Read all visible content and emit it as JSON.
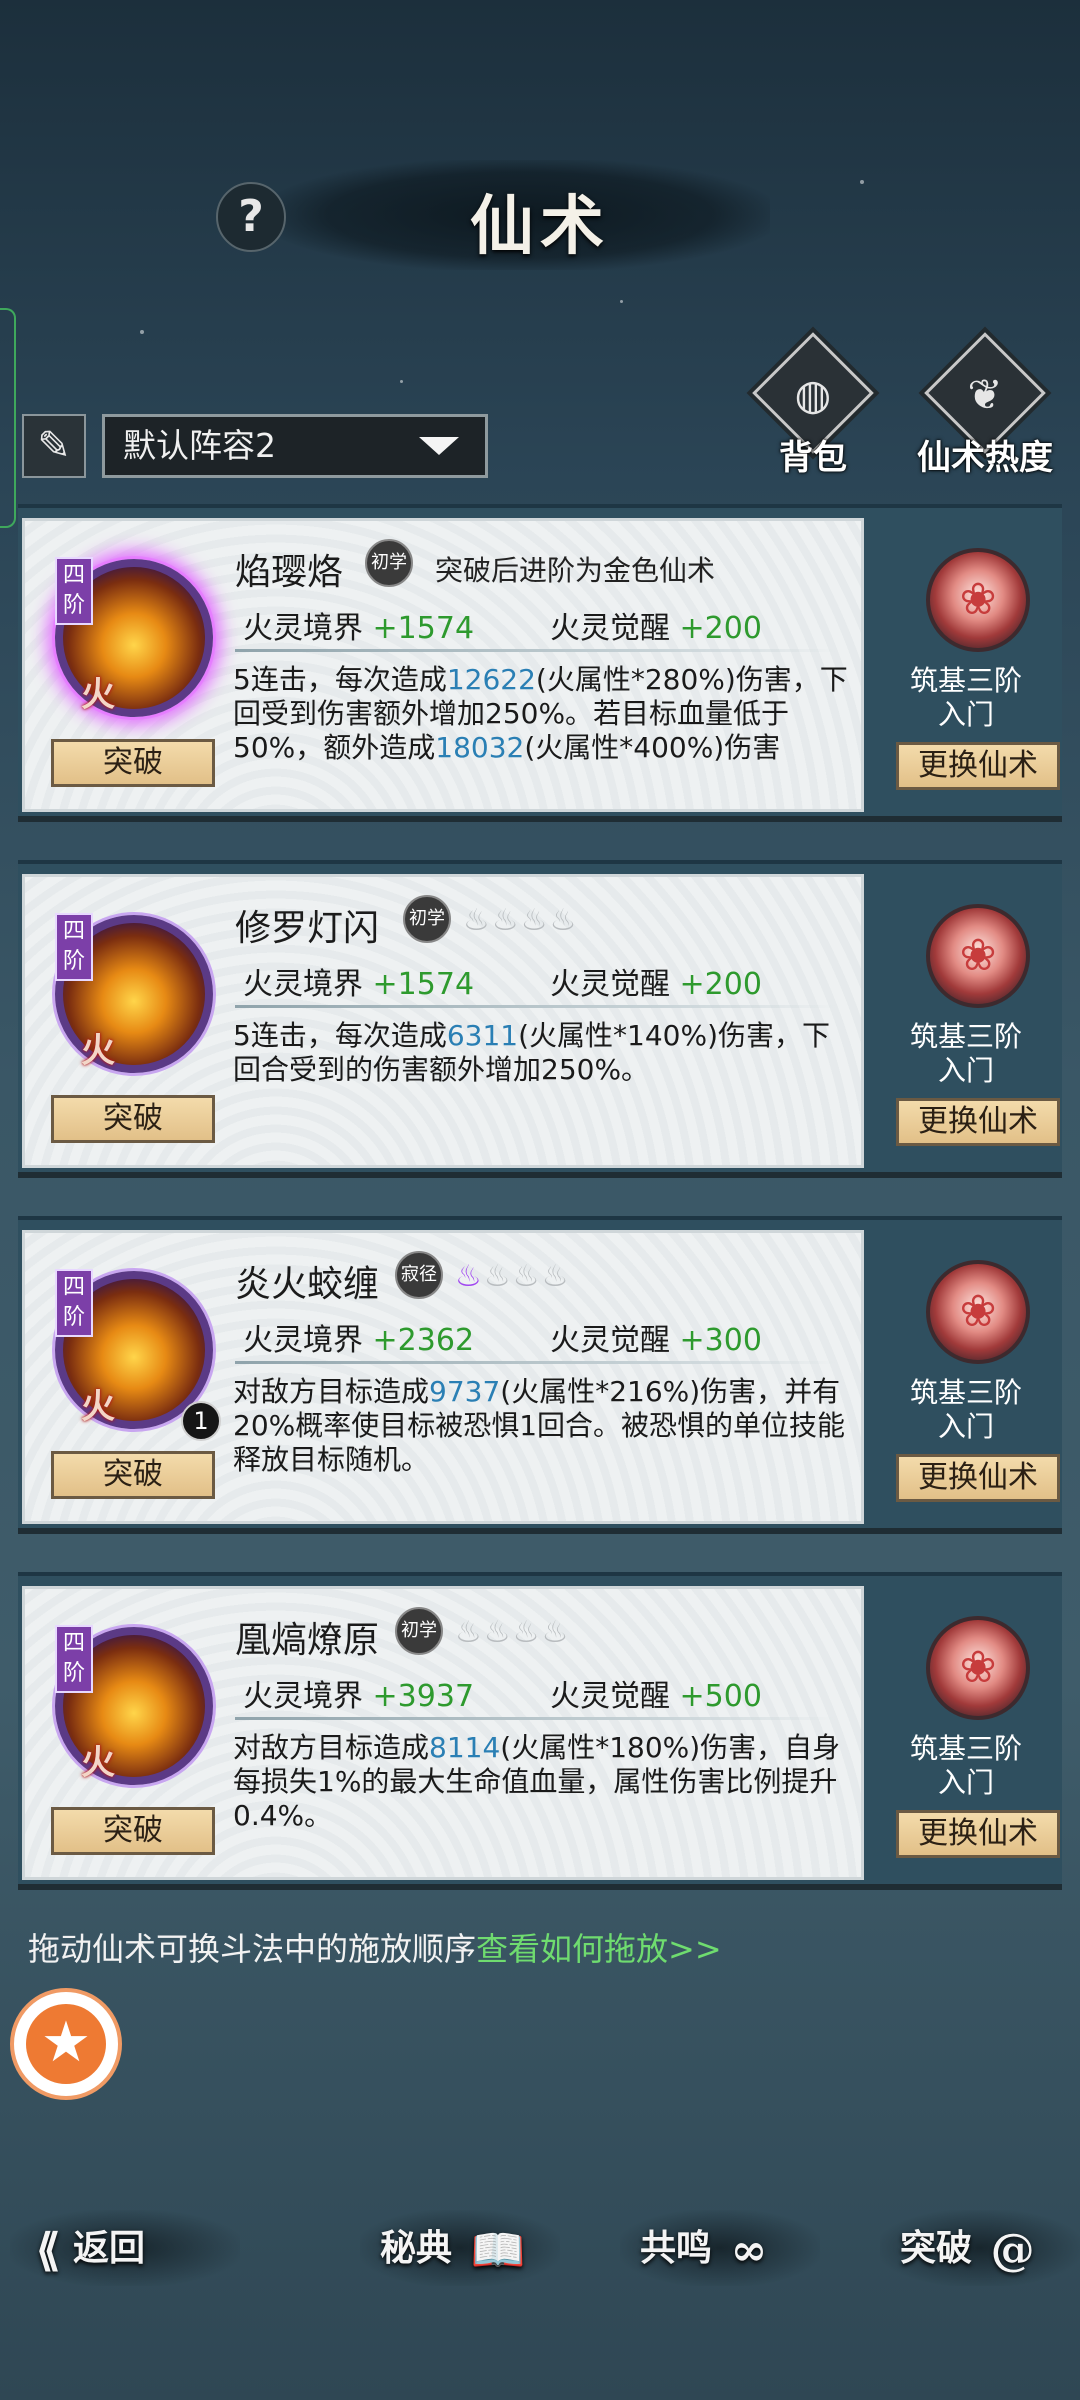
{
  "header": {
    "title": "仙术",
    "help_glyph": "?"
  },
  "toolbar": {
    "brush_glyph": "✎",
    "lineup_value": "默认阵容2",
    "bag_label": "背包",
    "bag_icon": "bag-icon",
    "popularity_label": "仙术热度",
    "popularity_icon": "book-icon"
  },
  "cards": [
    {
      "name": "焰璎烙",
      "level_badge": "初学",
      "promote_note": "突破后进阶为金色仙术",
      "rank": "四阶",
      "element": "火",
      "stat1_label": "火灵境界",
      "stat1_value": "+1574",
      "stat2_label": "火灵觉醒",
      "stat2_value": "+200",
      "desc": [
        {
          "t": "5连击，每次造成"
        },
        {
          "t": "12622",
          "n": true
        },
        {
          "t": "(火属性*280%)伤害，下回受到伤害额外增加250%。若目标血量低于50%，额外造成"
        },
        {
          "t": "18032",
          "n": true
        },
        {
          "t": "(火属性*400%)伤害"
        }
      ],
      "break_label": "突破",
      "realm": "筑基三阶\n入门",
      "realm_line1": "筑基三阶",
      "realm_line2": "入门",
      "swap_label": "更换仙术"
    },
    {
      "name": "修罗灯闪",
      "level_badge": "初学",
      "flames": "♨♨♨♨",
      "rank": "四阶",
      "element": "火",
      "stat1_label": "火灵境界",
      "stat1_value": "+1574",
      "stat2_label": "火灵觉醒",
      "stat2_value": "+200",
      "break_label": "突破",
      "realm_line1": "筑基三阶",
      "realm_line2": "入门",
      "swap_label": "更换仙术"
    },
    {
      "name": "炎火蛟缠",
      "level_badge": "寂径",
      "flames_on": "♨",
      "flames_off": "♨♨♨",
      "rank": "四阶",
      "element": "火",
      "badge_count": "1",
      "stat1_label": "火灵境界",
      "stat1_value": "+2362",
      "stat2_label": "火灵觉醒",
      "stat2_value": "+300",
      "break_label": "突破",
      "realm_line1": "筑基三阶",
      "realm_line2": "入门",
      "swap_label": "更换仙术"
    },
    {
      "name": "凰熇燎原",
      "level_badge": "初学",
      "flames": "♨♨♨♨",
      "rank": "四阶",
      "element": "火",
      "stat1_label": "火灵境界",
      "stat1_value": "+3937",
      "stat2_label": "火灵觉醒",
      "stat2_value": "+500",
      "break_label": "突破",
      "realm_line1": "筑基三阶",
      "realm_line2": "入门",
      "swap_label": "更换仙术"
    }
  ],
  "descs": {
    "c1": [
      "5连击，每次造成",
      "12622",
      "(火属性*280%)伤害，下回受到伤害额外增加250%。若目标血量低于50%，额外造成",
      "18032",
      "(火属性*400%)伤害"
    ],
    "c2": [
      "5连击，每次造成",
      "6311",
      "(火属性*140%)伤害，下回合受到的伤害额外增加250%。"
    ],
    "c3": [
      "对敌方目标造成",
      "9737",
      "(火属性*216%)伤害，并有20%概率使目标被恐惧1回合。被恐惧的单位技能释放目标随机。"
    ],
    "c4": [
      "对敌方目标造成",
      "8114",
      "(火属性*180%)伤害，自身每损失1%的最大生命值血量，属性伤害比例提升0.4%。"
    ]
  },
  "hint": {
    "text": "拖动仙术可换斗法中的施放顺序",
    "link": "查看如何拖放>>"
  },
  "fab_glyph": "★",
  "bottom_nav": {
    "back": "返回",
    "back_icon": "back-arrow-icon",
    "codex": "秘典",
    "codex_icon": "book-icon",
    "resonance": "共鸣",
    "resonance_icon": "swirl-icon",
    "breakthrough": "突破",
    "breakthrough_icon": "vortex-icon"
  },
  "colors": {
    "accent_green": "#2e9a2e",
    "number_blue": "#2a7fb4",
    "rank_purple": "#7c3fa8",
    "button_gold": "#e2c088"
  }
}
